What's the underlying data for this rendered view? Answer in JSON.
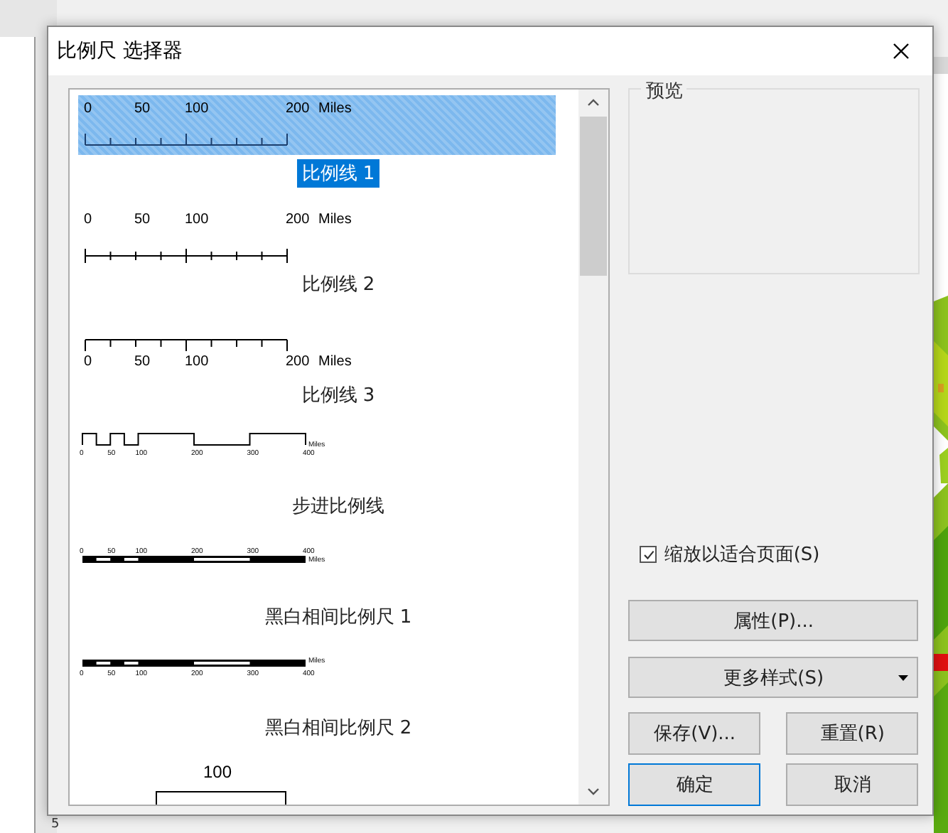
{
  "window": {
    "title": "比例尺 选择器"
  },
  "ruler_label": "5",
  "styles": [
    {
      "kind": "ticks-up",
      "tick_labels": [
        "0",
        "50",
        "100",
        "200"
      ],
      "units": "Miles",
      "label": "比例线 1",
      "selected": true
    },
    {
      "kind": "ticks-center",
      "tick_labels": [
        "0",
        "50",
        "100",
        "200"
      ],
      "units": "Miles",
      "label": "比例线 2",
      "selected": false
    },
    {
      "kind": "ticks-down",
      "tick_labels": [
        "0",
        "50",
        "100",
        "200"
      ],
      "units": "Miles",
      "label": "比例线 3",
      "selected": false
    },
    {
      "kind": "stepped",
      "tick_labels": [
        "0",
        "50",
        "100",
        "200",
        "300",
        "400"
      ],
      "units": "Miles",
      "label": "步进比例线",
      "selected": false
    },
    {
      "kind": "alternating-above",
      "tick_labels": [
        "0",
        "50",
        "100",
        "200",
        "300",
        "400"
      ],
      "units": "Miles",
      "label": "黑白相间比例尺 1",
      "selected": false
    },
    {
      "kind": "alternating-below",
      "tick_labels": [
        "0",
        "50",
        "100",
        "200",
        "300",
        "400"
      ],
      "units": "Miles",
      "label": "黑白相间比例尺 2",
      "selected": false
    },
    {
      "kind": "single-box",
      "tick_labels": [
        "100"
      ],
      "selected": false
    }
  ],
  "preview": {
    "title": "预览"
  },
  "fit_to_page": {
    "label": "缩放以适合页面(S)",
    "checked": true
  },
  "buttons": {
    "properties": "属性(P)...",
    "more_styles": "更多样式(S)",
    "save": "保存(V)...",
    "reset": "重置(R)",
    "ok": "确定",
    "cancel": "取消"
  }
}
